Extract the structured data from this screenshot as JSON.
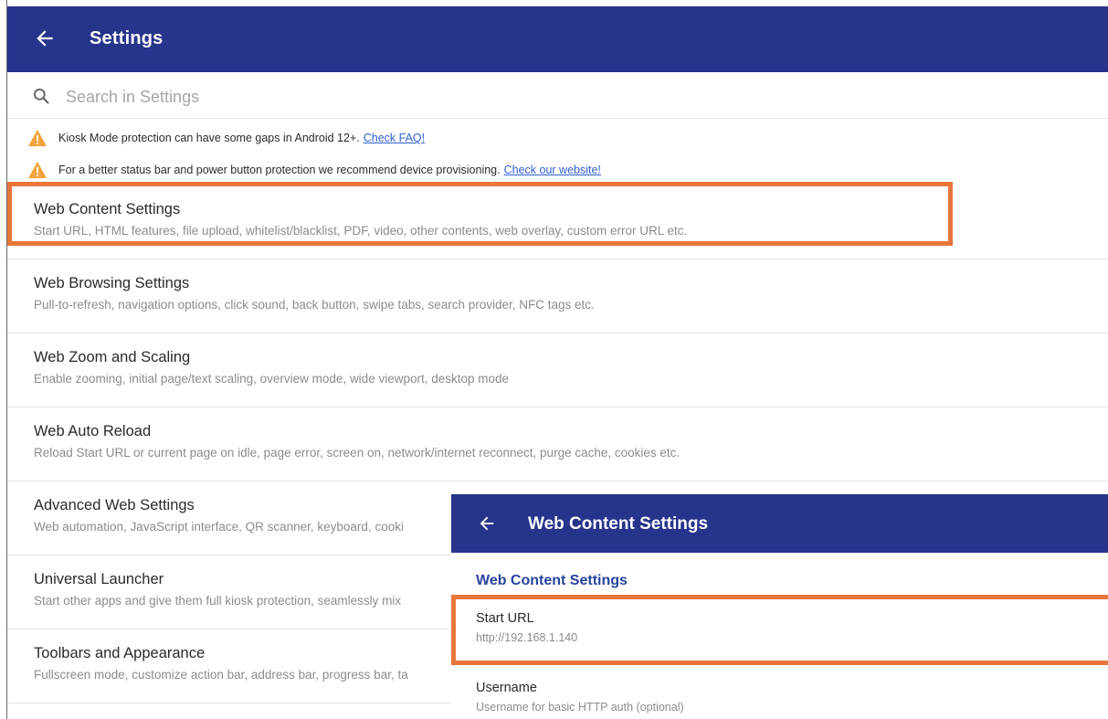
{
  "appbar": {
    "title": "Settings",
    "back_icon": "arrow-left-icon"
  },
  "search": {
    "placeholder": "Search in Settings",
    "value": ""
  },
  "warnings": [
    {
      "text": "Kiosk Mode protection can have some gaps in Android 12+.",
      "link": "Check FAQ!"
    },
    {
      "text": "For a better status bar and power button protection we recommend device provisioning.",
      "link": "Check our website!"
    }
  ],
  "settings": [
    {
      "title": "Web Content Settings",
      "summary": "Start URL, HTML features, file upload, whitelist/blacklist, PDF, video, other contents, web overlay, custom error URL etc."
    },
    {
      "title": "Web Browsing Settings",
      "summary": "Pull-to-refresh, navigation options, click sound, back button, swipe tabs, search provider, NFC tags etc."
    },
    {
      "title": "Web Zoom and Scaling",
      "summary": "Enable zooming, initial page/text scaling, overview mode, wide viewport, desktop mode"
    },
    {
      "title": "Web Auto Reload",
      "summary": "Reload Start URL or current page on idle, page error, screen on, network/internet reconnect, purge cache, cookies etc."
    },
    {
      "title": "Advanced Web Settings",
      "summary": "Web automation, JavaScript interface, QR scanner, keyboard, cooki"
    },
    {
      "title": "Universal Launcher",
      "summary": "Start other apps and give them full kiosk protection, seamlessly mix"
    },
    {
      "title": "Toolbars and Appearance",
      "summary": "Fullscreen mode, customize action bar, address bar, progress bar, ta"
    }
  ],
  "overlay": {
    "title": "Web Content Settings",
    "section_header": "Web Content Settings",
    "prefs": [
      {
        "title": "Start URL",
        "summary": "http://192.168.1.140"
      },
      {
        "title": "Username",
        "summary": "Username for basic HTTP auth (optional)"
      }
    ]
  },
  "colors": {
    "appbar": "#27348b",
    "highlight": "#e8763a",
    "section_header": "#2743a0",
    "warning": "#f2a33a",
    "link": "#2e5fd3"
  }
}
